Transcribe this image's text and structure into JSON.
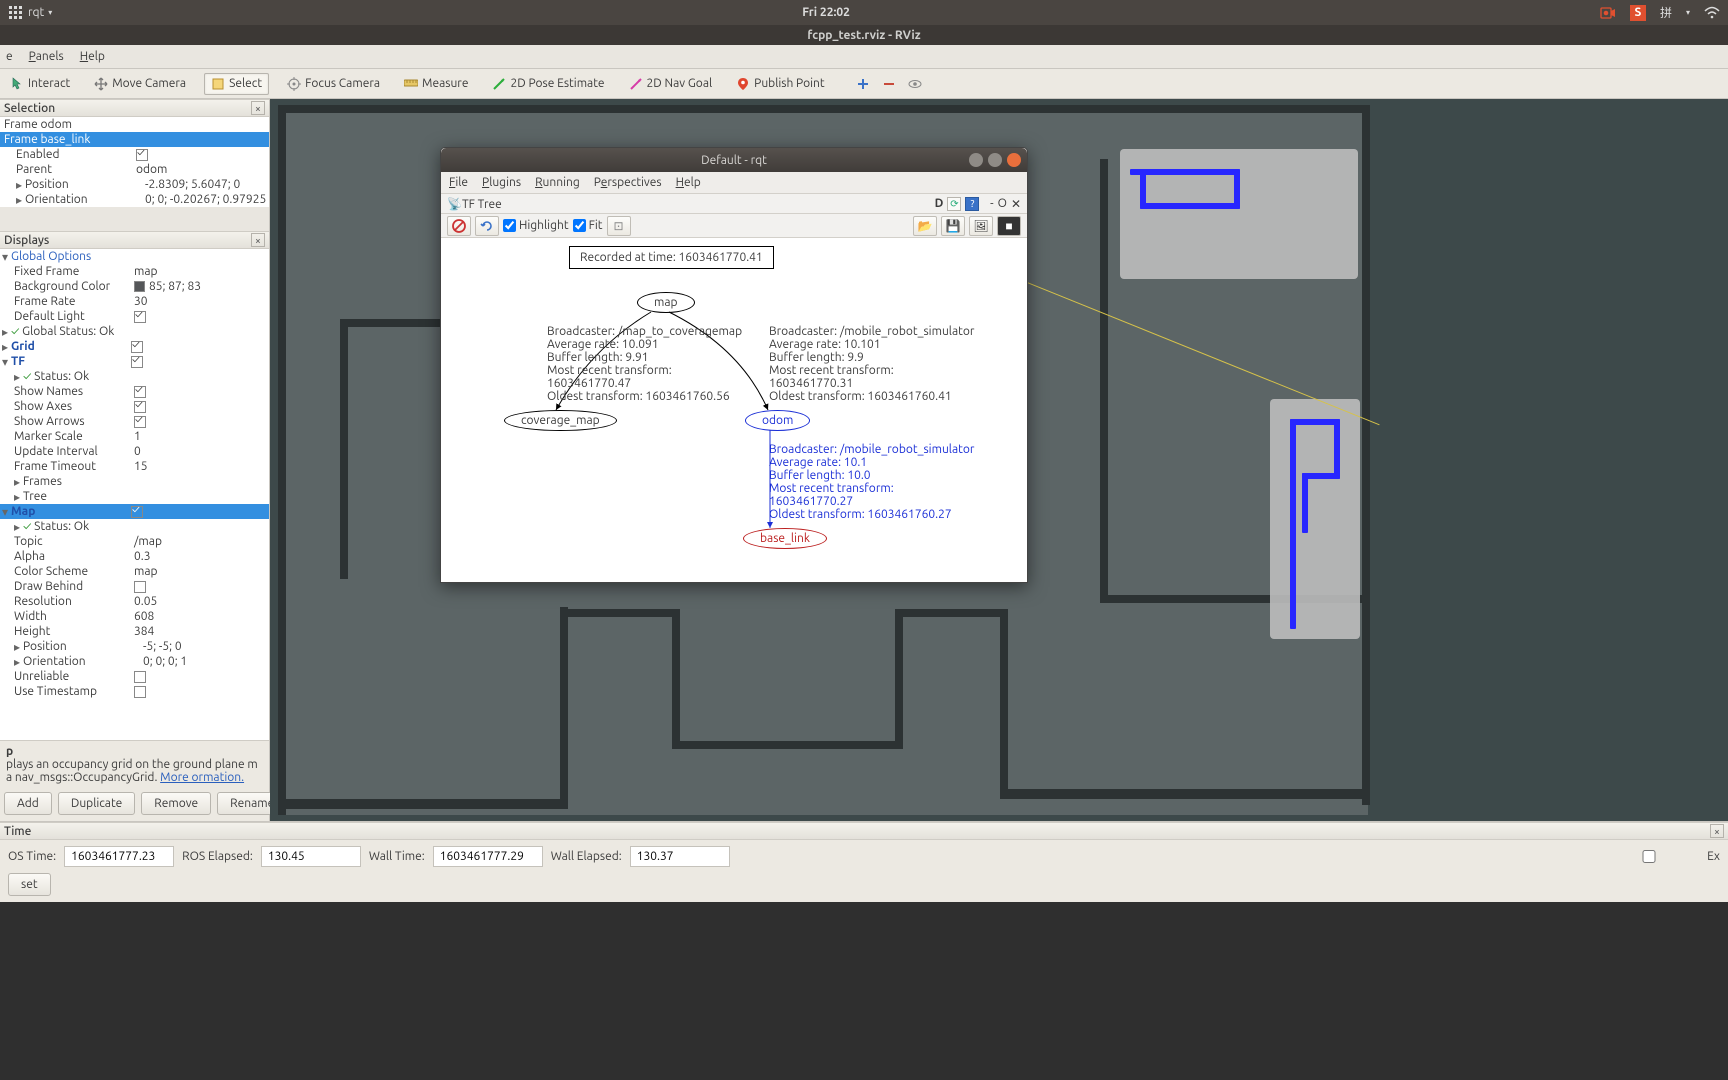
{
  "ubuntu_bar": {
    "app_name": "rqt",
    "clock": "Fri 22:02",
    "ime": "拼",
    "icons": [
      "record",
      "s-logo",
      "ime",
      "dropdown",
      "wifi"
    ]
  },
  "rviz": {
    "title": "fcpp_test.rviz - RViz",
    "menubar": [
      "e",
      "Panels",
      "Help"
    ],
    "toolbar": [
      {
        "label": "Interact",
        "icon": "interact"
      },
      {
        "label": "Move Camera",
        "icon": "move-camera"
      },
      {
        "label": "Select",
        "icon": "select",
        "active": true
      },
      {
        "label": "Focus Camera",
        "icon": "focus"
      },
      {
        "label": "Measure",
        "icon": "measure"
      },
      {
        "label": "2D Pose Estimate",
        "icon": "pose"
      },
      {
        "label": "2D Nav Goal",
        "icon": "nav"
      },
      {
        "label": "Publish Point",
        "icon": "pin"
      }
    ],
    "toolbar_right": [
      "plus",
      "minus",
      "eye"
    ],
    "selection": {
      "title": "Selection",
      "rows": [
        {
          "k": "Frame odom",
          "v": ""
        },
        {
          "k": "Frame base_link",
          "v": "",
          "sel": true
        },
        {
          "k": "Enabled",
          "v": "",
          "chk": true,
          "indent": 1
        },
        {
          "k": "Parent",
          "v": "odom",
          "indent": 1
        },
        {
          "k": "Position",
          "v": "-2.8309; 5.6047; 0",
          "indent": 1,
          "arrow": true
        },
        {
          "k": "Orientation",
          "v": "0; 0; -0.20267; 0.97925",
          "indent": 1,
          "arrow": true
        }
      ]
    },
    "displays": {
      "title": "Displays",
      "rows": [
        {
          "k": "Global Options",
          "style": "blue",
          "arrow": "down",
          "icon": "gear"
        },
        {
          "k": "Fixed Frame",
          "v": "map",
          "indent": 1
        },
        {
          "k": "Background Color",
          "v": "85; 87; 83",
          "indent": 1,
          "swatch": true
        },
        {
          "k": "Frame Rate",
          "v": "30",
          "indent": 1
        },
        {
          "k": "Default Light",
          "chk": true,
          "indent": 1
        },
        {
          "k": "Global Status: Ok",
          "status": true,
          "arrow": "right"
        },
        {
          "k": "Grid",
          "style": "bluebold",
          "chk": true,
          "arrow": "right",
          "icon": "grid"
        },
        {
          "k": "TF",
          "style": "bluebold",
          "chk": true,
          "arrow": "down",
          "icon": "tf"
        },
        {
          "k": "Status: Ok",
          "status": true,
          "indent": 1,
          "arrow": "right"
        },
        {
          "k": "Show Names",
          "chk": true,
          "indent": 1
        },
        {
          "k": "Show Axes",
          "chk": true,
          "indent": 1
        },
        {
          "k": "Show Arrows",
          "chk": true,
          "indent": 1
        },
        {
          "k": "Marker Scale",
          "v": "1",
          "indent": 1
        },
        {
          "k": "Update Interval",
          "v": "0",
          "indent": 1
        },
        {
          "k": "Frame Timeout",
          "v": "15",
          "indent": 1
        },
        {
          "k": "Frames",
          "indent": 1,
          "arrow": "right"
        },
        {
          "k": "Tree",
          "indent": 1,
          "arrow": "right"
        },
        {
          "k": "Map",
          "style": "bluebold",
          "chk": true,
          "arrow": "down",
          "sel": true,
          "icon": "map"
        },
        {
          "k": "Status: Ok",
          "status": true,
          "indent": 1,
          "arrow": "right"
        },
        {
          "k": "Topic",
          "v": "/map",
          "indent": 1
        },
        {
          "k": "Alpha",
          "v": "0.3",
          "indent": 1
        },
        {
          "k": "Color Scheme",
          "v": "map",
          "indent": 1
        },
        {
          "k": "Draw Behind",
          "chk": false,
          "indent": 1
        },
        {
          "k": "Resolution",
          "v": "0.05",
          "indent": 1
        },
        {
          "k": "Width",
          "v": "608",
          "indent": 1
        },
        {
          "k": "Height",
          "v": "384",
          "indent": 1
        },
        {
          "k": "Position",
          "v": "-5; -5; 0",
          "indent": 1,
          "arrow": "right"
        },
        {
          "k": "Orientation",
          "v": "0; 0; 0; 1",
          "indent": 1,
          "arrow": "right"
        },
        {
          "k": "Unreliable",
          "chk": false,
          "indent": 1
        },
        {
          "k": "Use Timestamp",
          "chk": false,
          "indent": 1
        }
      ],
      "desc_title": "p",
      "desc": "plays an occupancy grid on the ground plane m a nav_msgs::OccupancyGrid. ",
      "desc_link": "More ormation.",
      "buttons": [
        "Add",
        "Duplicate",
        "Remove",
        "Rename"
      ]
    },
    "time": {
      "title": "Time",
      "ros_time_lbl": "OS Time:",
      "ros_time": "1603461777.23",
      "ros_elapsed_lbl": "ROS Elapsed:",
      "ros_elapsed": "130.45",
      "wall_time_lbl": "Wall Time:",
      "wall_time": "1603461777.29",
      "wall_elapsed_lbl": "Wall Elapsed:",
      "wall_elapsed": "130.37",
      "exp_lbl": "Ex",
      "reset": "set"
    }
  },
  "rqt": {
    "title": "Default - rqt",
    "menu": [
      "File",
      "Plugins",
      "Running",
      "Perspectives",
      "Help"
    ],
    "sub_left": "TF Tree",
    "sub_right": [
      "D",
      "reload",
      "help",
      "-",
      "O",
      "X"
    ],
    "tb": {
      "highlight": "Highlight",
      "fit": "Fit"
    },
    "recorded": "Recorded at time: 1603461770.41",
    "nodes": {
      "map": "map",
      "coverage": "coverage_map",
      "odom": "odom",
      "base_link": "base_link"
    },
    "edge1": [
      "Broadcaster: /map_to_coveragemap",
      "Average rate: 10.091",
      "Buffer length: 9.91",
      "Most recent transform: 1603461770.47",
      "Oldest transform: 1603461760.56"
    ],
    "edge2": [
      "Broadcaster: /mobile_robot_simulator",
      "Average rate: 10.101",
      "Buffer length: 9.9",
      "Most recent transform: 1603461770.31",
      "Oldest transform: 1603461760.41"
    ],
    "edge3": [
      "Broadcaster: /mobile_robot_simulator",
      "Average rate: 10.1",
      "Buffer length: 10.0",
      "Most recent transform: 1603461770.27",
      "Oldest transform: 1603461760.27"
    ]
  }
}
